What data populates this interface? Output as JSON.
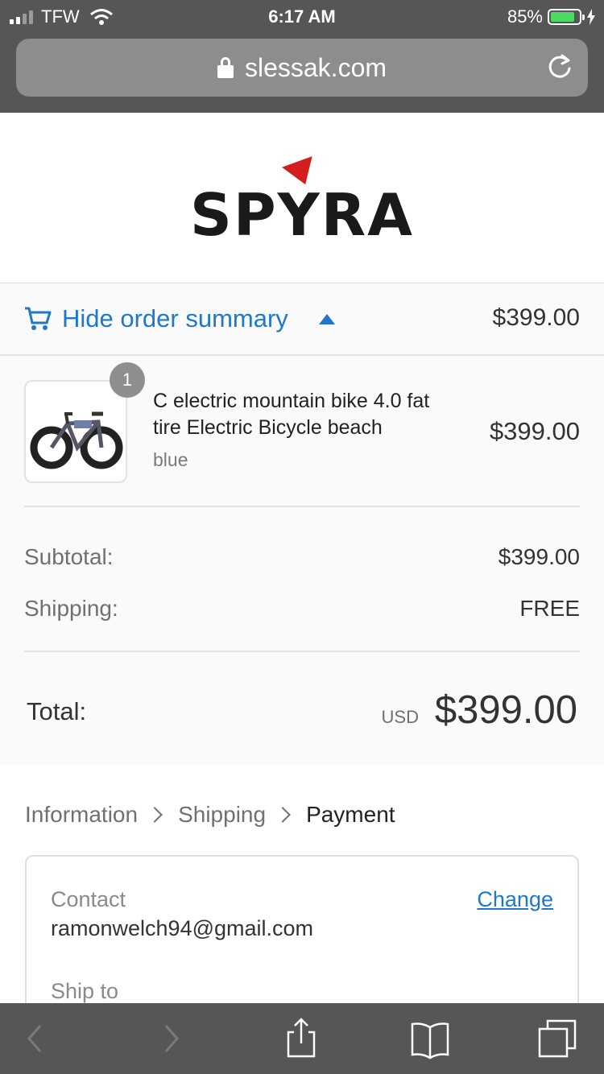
{
  "status_bar": {
    "carrier": "TFW",
    "time": "6:17 AM",
    "battery": "85%"
  },
  "browser": {
    "url": "slessak.com"
  },
  "brand": {
    "logo_text": "SPYRA"
  },
  "summary_toggle": {
    "label": "Hide order summary",
    "total": "$399.00"
  },
  "order": {
    "items": [
      {
        "quantity": "1",
        "name": "C electric mountain bike 4.0 fat tire Electric Bicycle beach",
        "variant": "blue",
        "price": "$399.00"
      }
    ],
    "subtotal_label": "Subtotal:",
    "subtotal_value": "$399.00",
    "shipping_label": "Shipping:",
    "shipping_value": "FREE",
    "total_label": "Total:",
    "currency": "USD",
    "total_value": "$399.00"
  },
  "breadcrumb": [
    "Information",
    "Shipping",
    "Payment"
  ],
  "review": {
    "contact_label": "Contact",
    "contact_value": "ramonwelch94@gmail.com",
    "change_label": "Change",
    "ship_to_label": "Ship to"
  },
  "colors": {
    "accent": "#1f78c8",
    "browser_chrome": "#565656",
    "logo_red": "#d41d1d",
    "battery_green": "#4cd964"
  }
}
